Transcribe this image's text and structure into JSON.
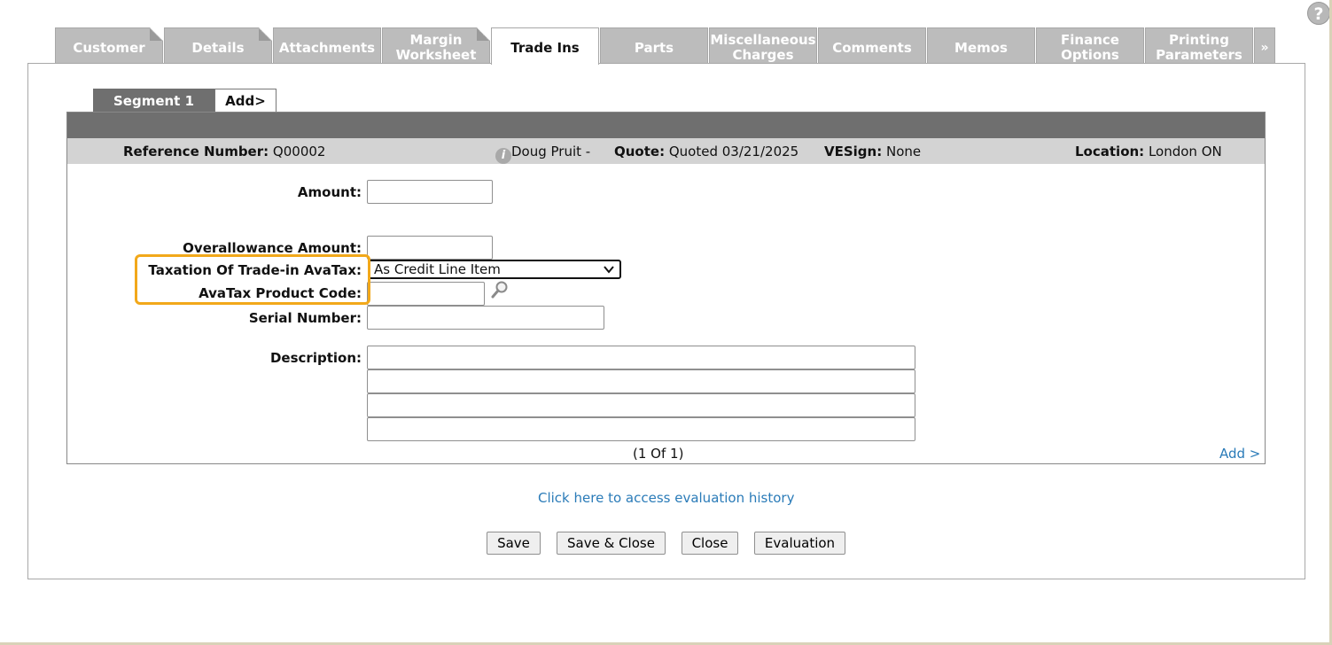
{
  "help_symbol": "?",
  "tabs": [
    {
      "label": "Customer",
      "active": false
    },
    {
      "label": "Details",
      "active": false
    },
    {
      "label": "Attachments",
      "active": false
    },
    {
      "label": "Margin Worksheet",
      "active": false
    },
    {
      "label": "Trade Ins",
      "active": true
    },
    {
      "label": "Parts",
      "active": false
    },
    {
      "label": "Miscellaneous Charges",
      "active": false
    },
    {
      "label": "Comments",
      "active": false
    },
    {
      "label": "Memos",
      "active": false
    },
    {
      "label": "Finance Options",
      "active": false
    },
    {
      "label": "Printing Parameters",
      "active": false
    }
  ],
  "tabs_more": "»",
  "segments": {
    "active": "Segment 1",
    "add": "Add>"
  },
  "info": {
    "ref_label": "Reference Number:",
    "ref_value": "Q00002",
    "info_symbol": "i",
    "person": "Doug Pruit  -",
    "quote_label": "Quote:",
    "quote_value": "Quoted 03/21/2025",
    "vesign_label": "VESign:",
    "vesign_value": "None",
    "location_label": "Location:",
    "location_value": "London ON"
  },
  "form": {
    "amount_label": "Amount:",
    "amount_value": "",
    "overallowance_label": "Overallowance Amount:",
    "overallowance_value": "",
    "taxation_label": "Taxation Of Trade-in AvaTax:",
    "taxation_value": "As Credit Line Item",
    "product_code_label": "AvaTax Product Code:",
    "product_code_value": "",
    "serial_label": "Serial Number:",
    "serial_value": "",
    "description_label": "Description:",
    "description_lines": [
      "",
      "",
      "",
      ""
    ]
  },
  "pager": "(1   Of  1)",
  "add_link": "Add >",
  "history_link": "Click here to access evaluation history",
  "buttons": {
    "save": "Save",
    "save_close": "Save & Close",
    "close": "Close",
    "evaluation": "Evaluation"
  },
  "colors": {
    "highlight": "#f2a81a",
    "link": "#2a7bb8",
    "tab_inactive": "#bcbcbc",
    "bar_dark": "#6f6f6f",
    "bar_light": "#d3d3d3"
  }
}
